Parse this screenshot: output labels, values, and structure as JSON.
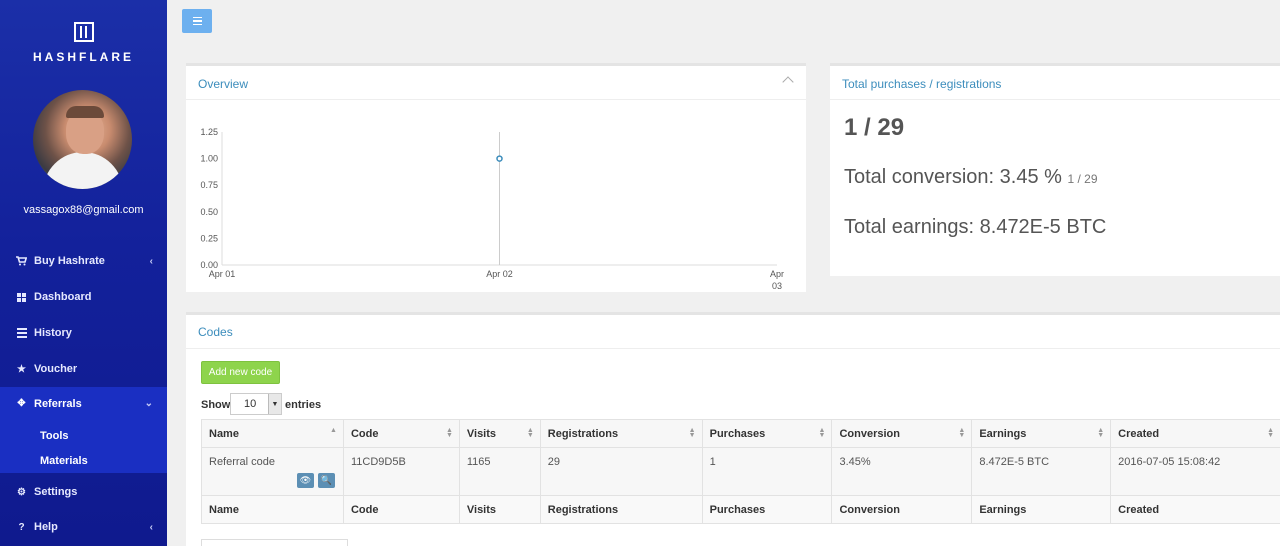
{
  "brand": {
    "name": "HASHFLARE",
    "primary": "#1b2fa8",
    "accent": "#3c8dbc",
    "success": "#8ed44c"
  },
  "user": {
    "email": "vassagox88@gmail.com"
  },
  "sidebar": {
    "items": [
      {
        "label": "Buy Hashrate",
        "icon": "cart-icon",
        "has_chevron": true
      },
      {
        "label": "Dashboard",
        "icon": "dashboard-icon"
      },
      {
        "label": "History",
        "icon": "list-icon"
      },
      {
        "label": "Voucher",
        "icon": "star-icon"
      },
      {
        "label": "Referrals",
        "icon": "referrals-icon",
        "active": true,
        "expanded": true
      },
      {
        "label": "Settings",
        "icon": "gears-icon"
      },
      {
        "label": "Help",
        "icon": "question-icon",
        "has_chevron": true
      }
    ],
    "subitems": [
      "Tools",
      "Materials"
    ]
  },
  "overview": {
    "title": "Overview",
    "chart_data": {
      "type": "line",
      "title": "",
      "x": [
        "Apr 01",
        "Apr 02",
        "Apr 03"
      ],
      "x_tick_labels": [
        "Apr 01",
        "Apr 02",
        "Apr\n03"
      ],
      "y_ticks": [
        "1.25",
        "1.00",
        "0.75",
        "0.50",
        "0.25",
        "0.00"
      ],
      "ylim": [
        0,
        1.25
      ],
      "series": [
        {
          "points": [
            {
              "x": "Apr 02",
              "y": 1.0
            }
          ]
        }
      ],
      "grid": false
    }
  },
  "totals": {
    "title": "Total purchases / registrations",
    "ratio": "1 / 29",
    "conversion_label": "Total conversion: 3.45 %",
    "conversion_small": "1 / 29",
    "earnings_label": "Total earnings: 8.472E-5 BTC"
  },
  "codes": {
    "title": "Codes",
    "add_button": "Add new code",
    "show_label": "Show",
    "entries_value": "10",
    "entries_label": "entries",
    "columns": [
      "Name",
      "Code",
      "Visits",
      "Registrations",
      "Purchases",
      "Conversion",
      "Earnings",
      "Created"
    ],
    "rows": [
      [
        "Referral code",
        "11CD9D5B",
        "1165",
        "29",
        "1",
        "3.45%",
        "8.472E-5 BTC",
        "2016-07-05 15:08:42"
      ]
    ]
  }
}
